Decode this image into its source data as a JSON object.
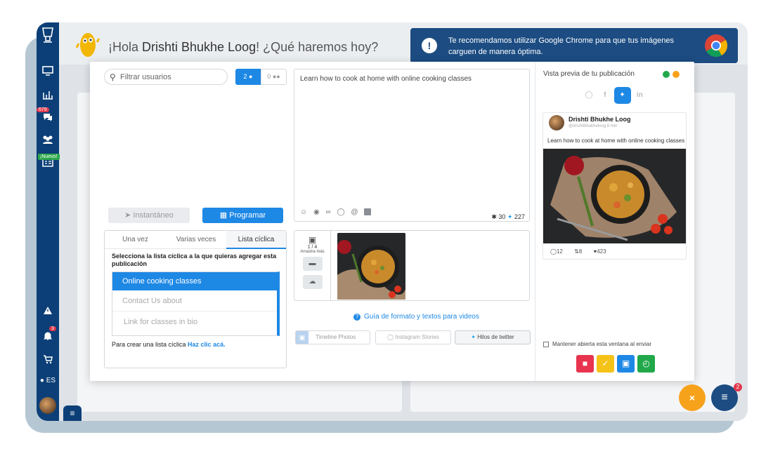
{
  "header": {
    "greeting_prefix": "¡Hola ",
    "user_name": "Drishti Bhukhe Loog",
    "greeting_suffix": "! ¿Qué haremos hoy?"
  },
  "chrome_banner": {
    "text": "Te recomendamos utilizar Google Chrome para que tus imágenes carguen de manera óptima."
  },
  "sidebar": {
    "messages_badge": "679",
    "new_label": "¡Nuevo!",
    "notif_badge": "3",
    "language": "ES"
  },
  "user_panel": {
    "search_placeholder": "Filtrar usuarios",
    "single_count": "2",
    "group_count": "0",
    "instant_label": "Instantáneo",
    "schedule_label": "Programar"
  },
  "schedule_tabs": {
    "tabs": [
      "Una vez",
      "Varias veces",
      "Lista cíclica"
    ],
    "active": "Lista cíclica",
    "instruction": "Selecciona la lista cíclica a la que quieras agregar esta publicación",
    "lists": [
      "Online cooking classes",
      "Contact Us about",
      "Link for classes in bio"
    ],
    "create_text": "Para crear una lista cíclica ",
    "create_link": "Haz clic acá."
  },
  "editor": {
    "text": "Learn how to cook at home with online cooking classes",
    "counter_general": "30",
    "counter_twitter": "227"
  },
  "media": {
    "count": "1 / 4",
    "drag_label": "Arrastra más",
    "guide_link": "Guía de formato y textos para videos"
  },
  "post_type_buttons": [
    "Timeline Photos",
    "Instagram Stories",
    "Hilos de twitter"
  ],
  "preview": {
    "title": "Vista previa de tu publicación",
    "networks": [
      "instagram",
      "facebook",
      "twitter",
      "linkedin"
    ],
    "active_network": "twitter",
    "author": "Drishti Bhukhe Loog",
    "handle": "@drishtibhukheloog",
    "time": "8 min",
    "text": "Learn how to cook at home with online cooking classes",
    "replies": "12",
    "retweets": "8",
    "likes": "423",
    "keep_open_label": "Mantener abierta esta ventana al enviar"
  },
  "fab": {
    "chat_badge": "2"
  },
  "colors": {
    "primary": "#1e88e5",
    "sidebar": "#0c3f77",
    "delete": "#e8344e",
    "approve": "#f5c218",
    "save": "#1e88e5",
    "schedule": "#21a84a",
    "fab_orange": "#f7a21b"
  }
}
